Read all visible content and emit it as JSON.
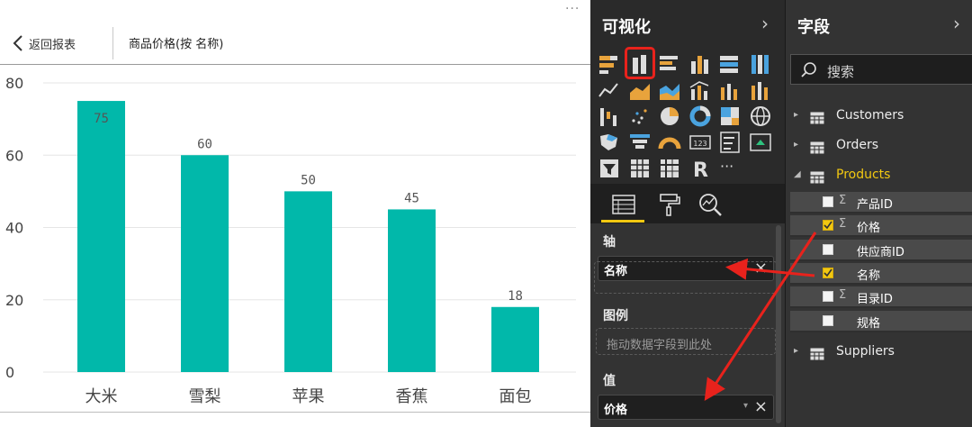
{
  "report": {
    "back_label": "返回报表",
    "page_title": "商品价格(按 名称)",
    "more": "···"
  },
  "chart_data": {
    "type": "bar",
    "categories": [
      "大米",
      "雪梨",
      "苹果",
      "香蕉",
      "面包"
    ],
    "values": [
      75,
      60,
      50,
      45,
      18
    ],
    "ylim": [
      0,
      80
    ],
    "yticks": [
      0,
      20,
      40,
      60,
      80
    ],
    "grid": true,
    "bar_color": "#01b8aa",
    "grid_color": "#e6e6e6"
  },
  "viz_pane": {
    "title": "可视化",
    "chevron": "›",
    "icons": [
      "stacked-bar-icon",
      "clustered-column-icon",
      "clustered-bar-icon",
      "stacked-column-icon",
      "100-bar-icon",
      "100-column-icon",
      "line-icon",
      "area-icon",
      "stacked-area-icon",
      "line-column-icon",
      "line-clustered-icon",
      "ribbon-icon",
      "waterfall-icon",
      "scatter-icon",
      "pie-icon",
      "donut-icon",
      "treemap-icon",
      "map-icon",
      "filled-map-icon",
      "funnel-icon",
      "gauge-icon",
      "card-icon",
      "multirow-card-icon",
      "kpi-icon",
      "slicer-icon",
      "table-icon",
      "matrix-icon",
      "r-visual-icon",
      "more-icon"
    ],
    "more_glyph": "···",
    "r_glyph": "R",
    "card_glyph": "123",
    "tabs": [
      "fields-tab",
      "format-tab",
      "analytics-tab"
    ],
    "wells": {
      "axis_title": "轴",
      "axis_field": "名称",
      "legend_title": "图例",
      "legend_placeholder": "拖动数据字段到此处",
      "value_title": "值",
      "value_field": "价格",
      "remove_glyph": "×",
      "dropdown_glyph": "▾"
    },
    "accent_color": "#f2c811",
    "highlight_color": "#e8221c"
  },
  "fields_pane": {
    "title": "字段",
    "chevron": "›",
    "search_placeholder": "搜索",
    "sigma": "Σ",
    "tables": [
      {
        "name": "Customers",
        "expanded": false
      },
      {
        "name": "Orders",
        "expanded": false
      },
      {
        "name": "Products",
        "expanded": true
      },
      {
        "name": "Suppliers",
        "expanded": false
      }
    ],
    "product_fields": [
      {
        "name": "产品ID",
        "checked": false,
        "sigma": true
      },
      {
        "name": "价格",
        "checked": true,
        "sigma": true
      },
      {
        "name": "供应商ID",
        "checked": false,
        "sigma": false
      },
      {
        "name": "名称",
        "checked": true,
        "sigma": false
      },
      {
        "name": "目录ID",
        "checked": false,
        "sigma": true
      },
      {
        "name": "规格",
        "checked": false,
        "sigma": false
      }
    ],
    "arrow_collapsed": "▸",
    "arrow_expanded": "◢",
    "products_color": "#f2c811"
  }
}
